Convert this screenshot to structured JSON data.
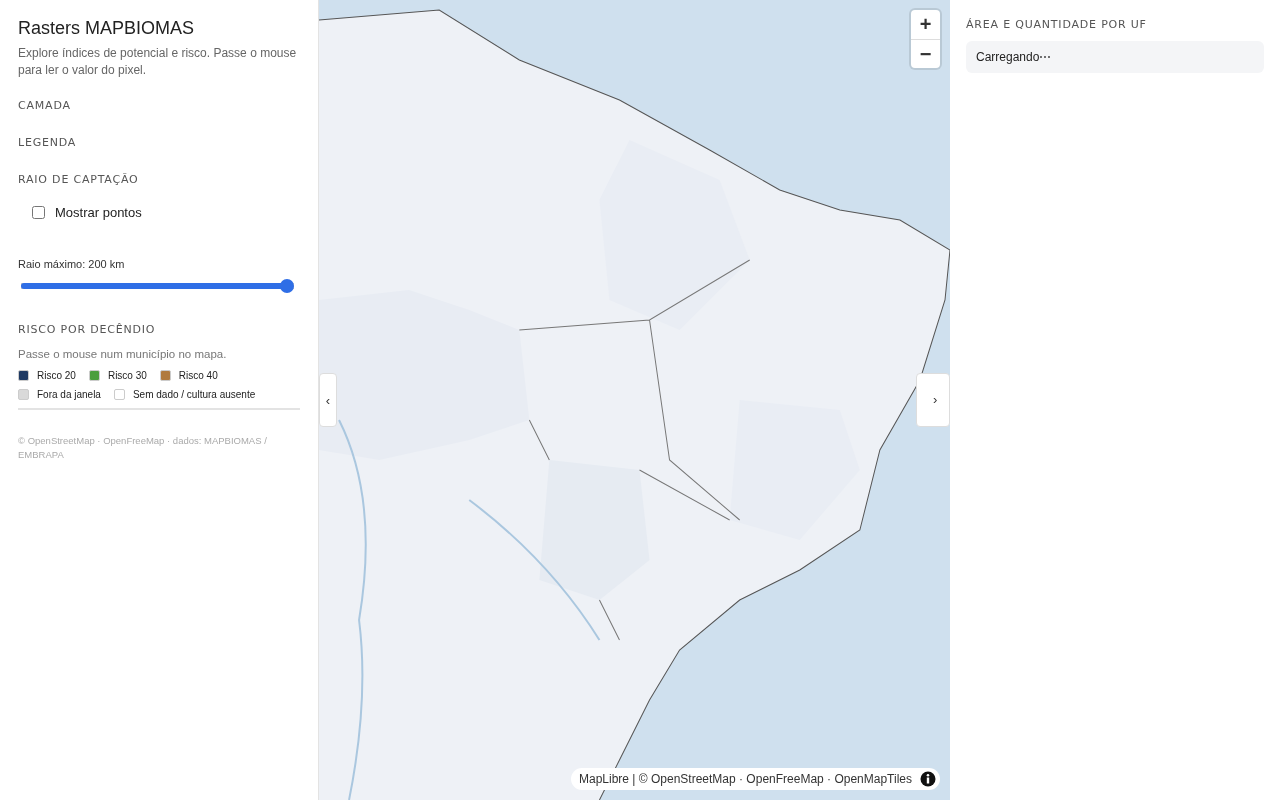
{
  "sidebar": {
    "title": "Rasters MAPBIOMAS",
    "description": "Explore índices de potencial e risco. Passe o mouse para ler o valor do pixel.",
    "sections": [
      {
        "heading": "CAMADA"
      },
      {
        "heading": "LEGENDA"
      },
      {
        "heading": "RAIO DE CAPTAÇÃO"
      }
    ],
    "show_points": {
      "label": "Mostrar pontos",
      "checked": false
    },
    "radius": {
      "label": "Raio máximo: 200 km",
      "level": 1.0
    },
    "risk": {
      "heading": "RISCO POR DECÊNDIO",
      "hint": "Passe o mouse num município no mapa.",
      "legend": [
        {
          "label": "Risco 20",
          "color": "#1f3a63"
        },
        {
          "label": "Risco 30",
          "color": "#4a9e3d"
        },
        {
          "label": "Risco 40",
          "color": "#b07a3e"
        },
        {
          "label": "Fora da janela",
          "color": "#d9d9d9"
        },
        {
          "label": "Sem dado / cultura ausente",
          "color": "#ffffff"
        }
      ]
    },
    "credits": "© OpenStreetMap · OpenFreeMap · dados: MAPBIOMAS / EMBRAPA"
  },
  "map": {
    "kind": "picture",
    "zoom_in": "+",
    "zoom_out": "−",
    "collapse_left": "‹",
    "collapse_right": "›",
    "attribution": "MapLibre | © OpenStreetMap · OpenFreeMap · OpenMapTiles"
  },
  "right_panel": {
    "heading": "ÁREA E QUANTIDADE POR UF",
    "status": "Carregando⋯"
  }
}
